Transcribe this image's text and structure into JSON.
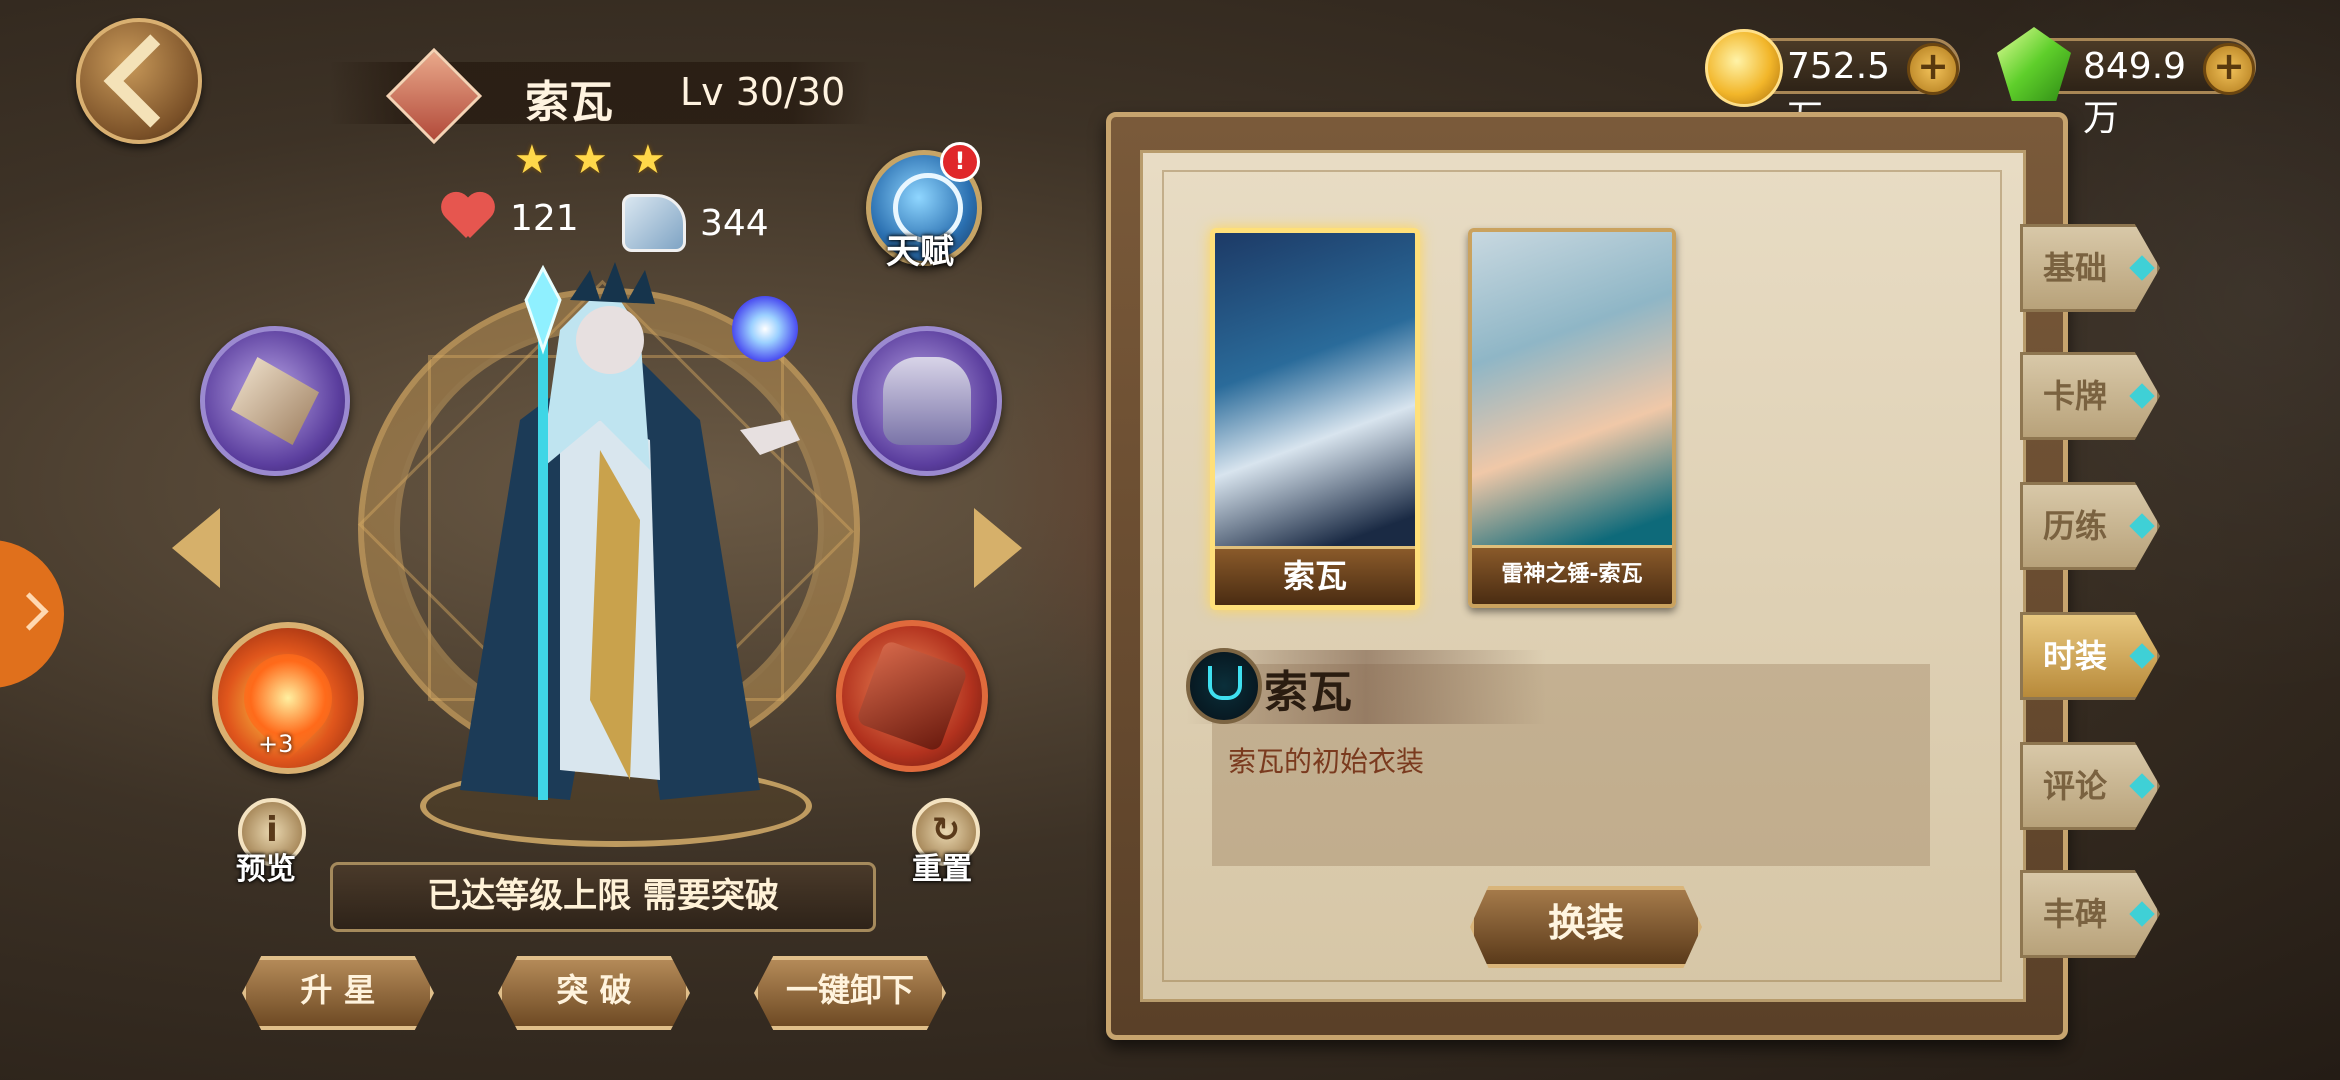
{
  "hero": {
    "name": "索瓦",
    "level": "Lv 30/30",
    "stars": [
      "★",
      "★",
      "★"
    ],
    "hp": "121",
    "speed": "344"
  },
  "talent": {
    "label": "天赋",
    "alert": "!"
  },
  "rune": {
    "plus": "+3"
  },
  "actions": {
    "preview_label": "预览",
    "preview_icon": "i",
    "reset_label": "重置",
    "reset_icon": "↻",
    "notice": "已达等级上限 需要突破",
    "upgrade_star": "升 星",
    "breakthrough": "突 破",
    "unequip_all": "一键卸下"
  },
  "currency": {
    "gold": "752.5万",
    "gems": "849.9万",
    "plus": "+"
  },
  "skins": [
    {
      "label": "索瓦",
      "selected": true
    },
    {
      "label": "雷神之锤-索瓦",
      "selected": false
    }
  ],
  "skin_detail": {
    "name": "索瓦",
    "description": "索瓦的初始衣装",
    "equip_label": "换装"
  },
  "tabs": [
    "基础",
    "卡牌",
    "历练",
    "时装",
    "评论",
    "丰碑"
  ],
  "active_tab": "时装",
  "colors": {
    "accent_gold": "#d9b071",
    "panel_paper": "#e8dcc4",
    "active_tab": "#e8c880",
    "side_tab": "#e0701c"
  }
}
